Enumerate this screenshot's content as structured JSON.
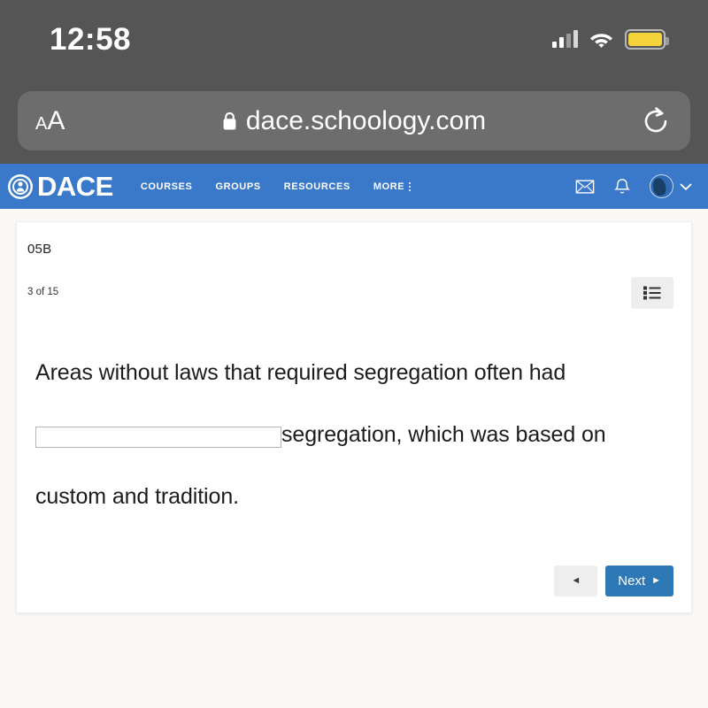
{
  "status_bar": {
    "time": "12:58",
    "signal_icon": "signal-bars-icon",
    "wifi_icon": "wifi-icon",
    "battery_icon": "battery-icon",
    "battery_color": "#f5d33a"
  },
  "browser": {
    "text_size_label_small": "A",
    "text_size_label_large": "A",
    "lock_icon": "lock-icon",
    "url": "dace.schoology.com",
    "reload_icon": "reload-icon",
    "bar_color": "#555555",
    "pill_color": "#6d6d6d"
  },
  "app_nav": {
    "brand_name": "DACE",
    "brand_seal_icon": "university-seal-icon",
    "nav_color": "#3a78c9",
    "links": [
      {
        "label": "COURSES"
      },
      {
        "label": "GROUPS"
      },
      {
        "label": "RESOURCES"
      }
    ],
    "more_label": "MORE",
    "more_icon": "kebab-menu-icon",
    "messages_icon": "envelope-icon",
    "notifications_icon": "bell-icon",
    "avatar_icon": "user-avatar",
    "account_chevron_icon": "chevron-down-icon"
  },
  "card": {
    "title": "05B",
    "progress": "3 of 15",
    "list_view_icon": "list-view-icon"
  },
  "question": {
    "text_before": "Areas without laws that required segregation often had",
    "blank_value": "",
    "blank_placeholder": "",
    "text_after": "segregation, which was based on custom and tradition.",
    "full_text": "Areas without laws that required segregation often had ______ segregation, which was based on custom and tradition."
  },
  "footer": {
    "prev_label": "",
    "prev_icon": "triangle-left-icon",
    "next_label": "Next",
    "next_icon": "triangle-right-icon",
    "next_color": "#2d78b5"
  }
}
